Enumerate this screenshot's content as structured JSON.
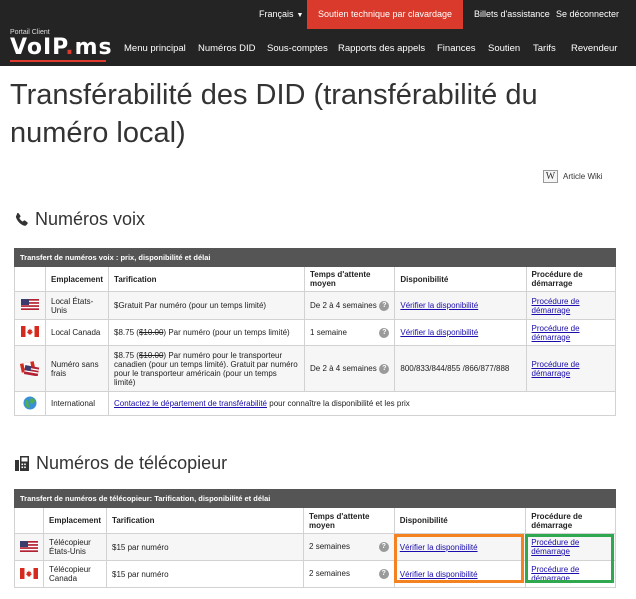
{
  "topbar": {
    "language": "Français",
    "support": "Soutien technique par clavardage",
    "tickets": "Billets d'assistance",
    "logout": "Se déconnecter"
  },
  "logo": {
    "portal": "Portail Client",
    "brand_a": "VoIP",
    "brand_dot": ".",
    "brand_b": "ms"
  },
  "nav": [
    "Menu principal",
    "Numéros DID",
    "Sous-comptes",
    "Rapports des appels",
    "Finances",
    "Soutien",
    "Tarifs",
    "Revendeur"
  ],
  "page": {
    "title": "Transférabilité des DID (transférabilité du numéro local)",
    "wiki_icon": "W",
    "wiki": "Article Wiki"
  },
  "voice": {
    "heading": "Numéros voix",
    "icon": "phone-icon",
    "caption": "Transfert de numéros voix : prix, disponibilité et délai",
    "headers": [
      "Emplacement",
      "Tarification",
      "Temps d'attente moyen",
      "Disponibilité",
      "Procédure de démarrage"
    ],
    "rows": [
      {
        "flag": "us-flag-icon",
        "location": "Local États-Unis",
        "pricing": "$Gratuit Par numéro (pour un temps limité)",
        "wait": "De 2 à 4 semaines",
        "availability": "Vérifier la disponibilité",
        "procedure": "Procédure de démarrage"
      },
      {
        "flag": "ca-flag-icon",
        "location": "Local Canada",
        "price_new": "$8.75",
        "price_old": "$10.00",
        "pricing": "Par numéro (pour un temps limité)",
        "wait": "1 semaine",
        "availability": "Vérifier la disponibilité",
        "procedure": "Procédure de démarrage"
      },
      {
        "flag": "us-ca-flag-icon",
        "location": "Numéro sans frais",
        "price_new": "$8.75",
        "price_old": "$10.00",
        "pricing": "Par numéro pour le transporteur canadien (pour un temps limité). Gratuit par numéro pour le transporteur américain (pour un temps limité)",
        "wait": "De 2 à 4 semaines",
        "availability": "800/833/844/855 /866/877/888",
        "procedure": "Procédure de démarrage"
      },
      {
        "flag": "globe-icon",
        "location": "International",
        "link": "Contactez le département de transférabilité",
        "suffix": " pour connaître la disponibilité et les prix"
      }
    ]
  },
  "fax": {
    "heading": "Numéros de télécopieur",
    "icon": "fax-icon",
    "caption": "Transfert de numéros de télécopieur: Tarification, disponibilité et délai",
    "headers": [
      "Emplacement",
      "Tarification",
      "Temps d'attente moyen",
      "Disponibilité",
      "Procédure de démarrage"
    ],
    "rows": [
      {
        "flag": "us-flag-icon",
        "location": "Télécopieur États-Unis",
        "pricing": "$15 par numéro",
        "wait": "2 semaines",
        "availability": "Vérifier la disponibilité",
        "procedure": "Procédure de démarrage"
      },
      {
        "flag": "ca-flag-icon",
        "location": "Télécopieur Canada",
        "pricing": "$15 par numéro",
        "wait": "2 semaines",
        "availability": "Vérifier la disponibilité",
        "procedure": "Procédure de démarrage"
      }
    ]
  },
  "qmark": "?",
  "colors": {
    "header_bg": "#242424",
    "support_bg": "#d93a2b",
    "highlight_orange": "#f58220",
    "highlight_green": "#2fa84f"
  }
}
